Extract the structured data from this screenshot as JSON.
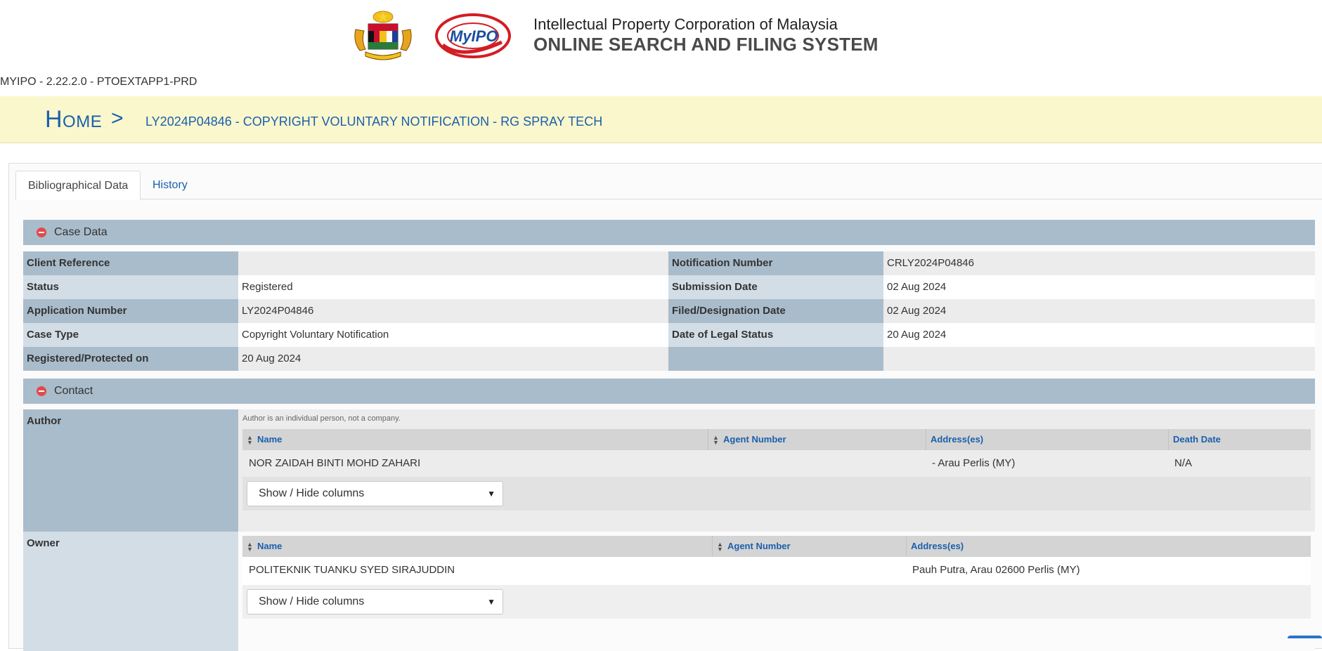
{
  "header": {
    "org_name": "Intellectual Property Corporation of Malaysia",
    "system_name": "ONLINE SEARCH AND FILING SYSTEM",
    "logo_text": "MyIPO",
    "version": "MYIPO  - 2.22.2.0 - PTOEXTAPP1-PRD"
  },
  "breadcrumb": {
    "home": "Home",
    "separator": ">",
    "title": "LY2024P04846 - COPYRIGHT VOLUNTARY NOTIFICATION - RG SPRAY TECH"
  },
  "tabs": [
    {
      "label": "Bibliographical Data",
      "active": true
    },
    {
      "label": "History",
      "active": false
    }
  ],
  "case_data": {
    "section_label": "Case Data",
    "left": [
      {
        "label": "Client Reference",
        "value": ""
      },
      {
        "label": "Status",
        "value": "Registered"
      },
      {
        "label": "Application Number",
        "value": "LY2024P04846"
      },
      {
        "label": "Case Type",
        "value": "Copyright Voluntary Notification"
      },
      {
        "label": "Registered/Protected on",
        "value": "20 Aug 2024"
      }
    ],
    "right": [
      {
        "label": "Notification Number",
        "value": "CRLY2024P04846"
      },
      {
        "label": "Submission Date",
        "value": "02 Aug 2024"
      },
      {
        "label": "Filed/Designation Date",
        "value": "02 Aug 2024"
      },
      {
        "label": "Date of Legal Status",
        "value": "20 Aug 2024"
      },
      {
        "label": "",
        "value": ""
      }
    ]
  },
  "contact": {
    "section_label": "Contact",
    "author": {
      "label": "Author",
      "note": "Author is an individual person, not a company.",
      "columns": [
        "Name",
        "Agent Number",
        "Address(es)",
        "Death Date"
      ],
      "rows": [
        {
          "name": "NOR ZAIDAH BINTI MOHD ZAHARI",
          "agent_number": "",
          "address": "- Arau Perlis (MY)",
          "death_date": "N/A"
        }
      ],
      "column_select": "Show / Hide columns"
    },
    "owner": {
      "label": "Owner",
      "columns": [
        "Name",
        "Agent Number",
        "Address(es)"
      ],
      "rows": [
        {
          "name": "POLITEKNIK TUANKU SYED SIRAJUDDIN",
          "agent_number": "",
          "address": "Pauh Putra, Arau 02600 Perlis (MY)"
        }
      ],
      "column_select": "Show / Hide columns"
    }
  },
  "colors": {
    "link_blue": "#1b5fad",
    "breadcrumb_bg": "#faf7cc",
    "section_bar": "#a9bccb",
    "label_light": "#d3dde6",
    "collapse_icon": "#e24a4a"
  }
}
